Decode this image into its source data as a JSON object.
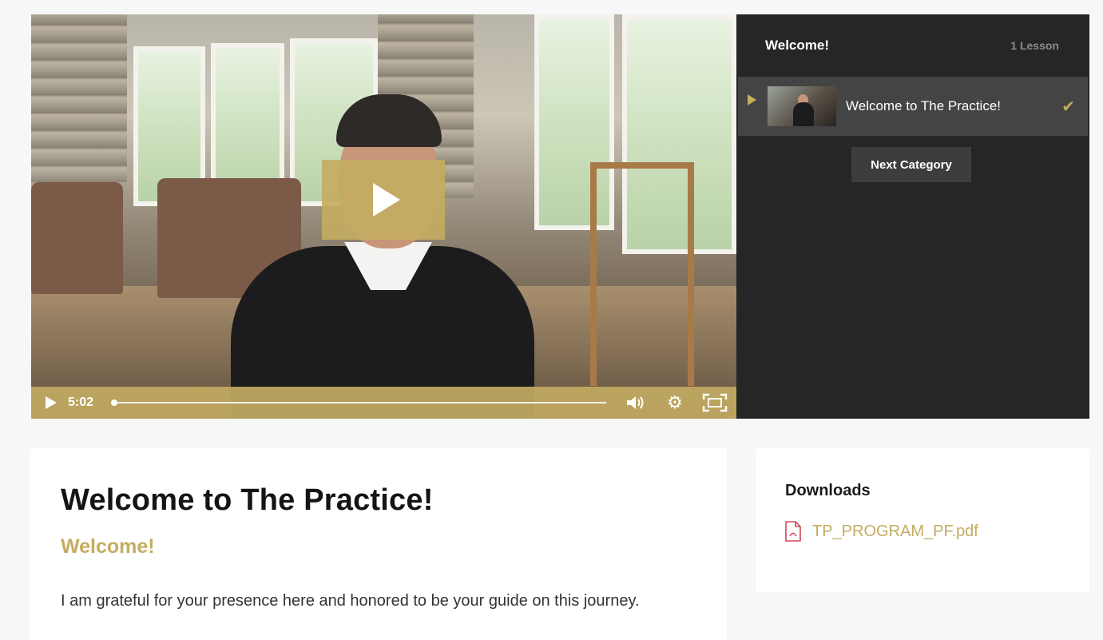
{
  "video": {
    "time": "5:02",
    "progress_fraction": 0.0,
    "accent_color": "#c4ac60"
  },
  "sidebar": {
    "title": "Welcome!",
    "lesson_count": "1 Lesson",
    "lessons": [
      {
        "title": "Welcome to The Practice!",
        "completed": true
      }
    ],
    "next_button": "Next Category"
  },
  "content": {
    "title": "Welcome to The Practice!",
    "subtitle": "Welcome!",
    "body": "I am grateful for your presence here and honored to be your guide on this journey."
  },
  "downloads": {
    "title": "Downloads",
    "files": [
      {
        "name": "TP_PROGRAM_PF.pdf",
        "icon": "pdf-file-icon"
      }
    ]
  }
}
